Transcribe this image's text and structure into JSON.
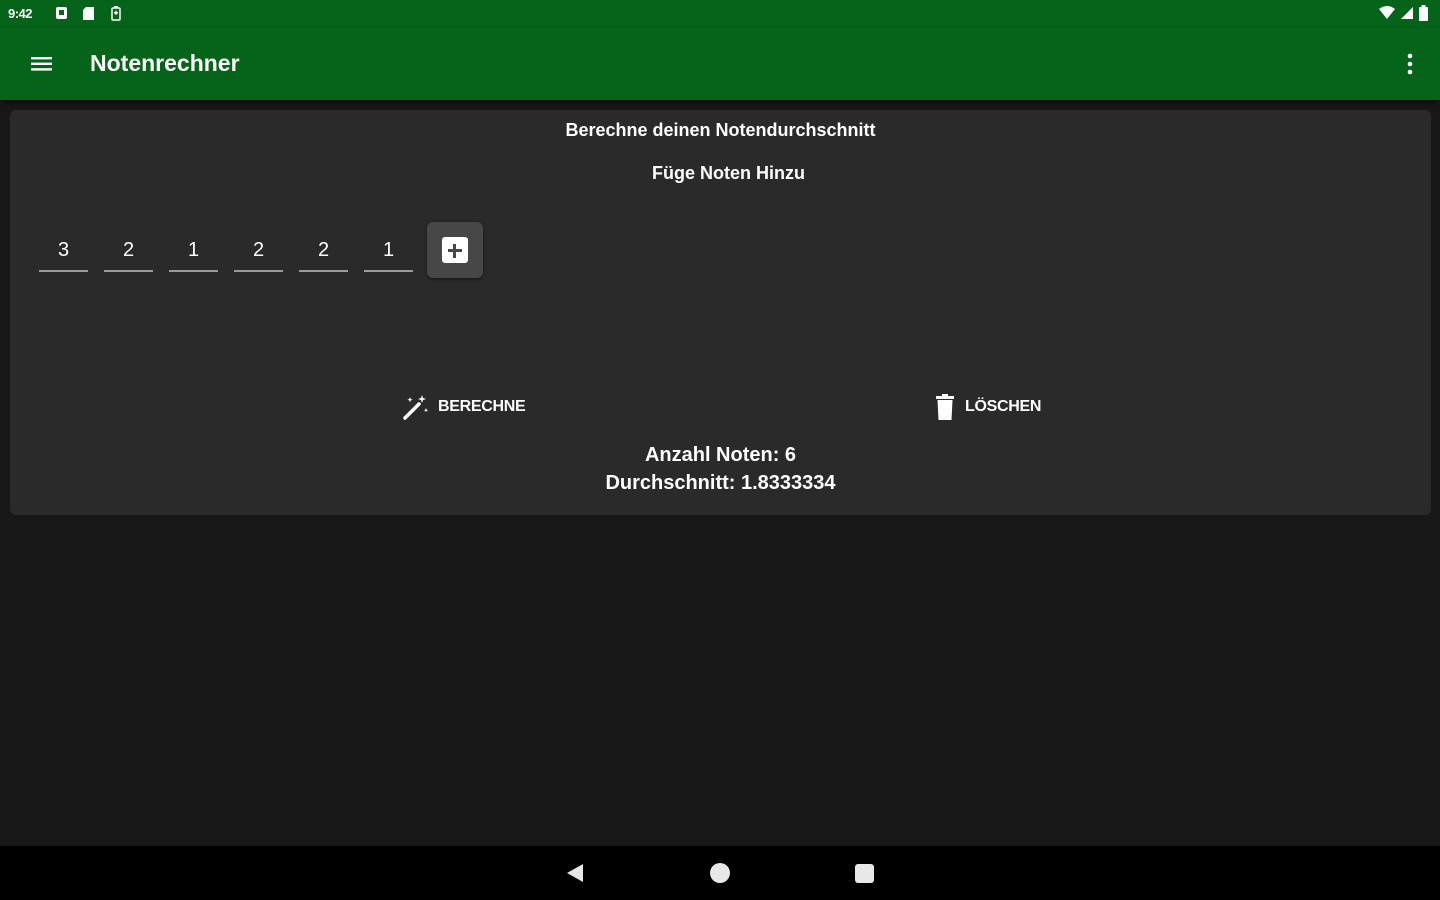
{
  "status_bar": {
    "time": "9:42",
    "left_icons": [
      "notification-icon",
      "sd-card-icon",
      "battery-saver-icon"
    ],
    "right_icons": [
      "wifi-icon",
      "signal-icon",
      "battery-icon"
    ]
  },
  "app_bar": {
    "title": "Notenrechner",
    "menu_icon": "hamburger-menu-icon",
    "overflow_icon": "more-vert-icon",
    "color": "#05631a"
  },
  "card": {
    "title": "Berechne deinen Notendurchschnitt",
    "subtitle": "Füge Noten Hinzu",
    "grades": [
      "3",
      "2",
      "1",
      "2",
      "2",
      "1"
    ],
    "add_icon": "add-box-icon",
    "calculate_label": "BERECHNE",
    "calculate_icon": "magic-wand-icon",
    "clear_label": "LÖSCHEN",
    "clear_icon": "trash-icon",
    "count_text": "Anzahl Noten: 6",
    "average_text": "Durchschnitt: 1.8333334"
  },
  "nav_bar": {
    "back_icon": "back-triangle-icon",
    "home_icon": "home-circle-icon",
    "recents_icon": "recents-square-icon"
  }
}
